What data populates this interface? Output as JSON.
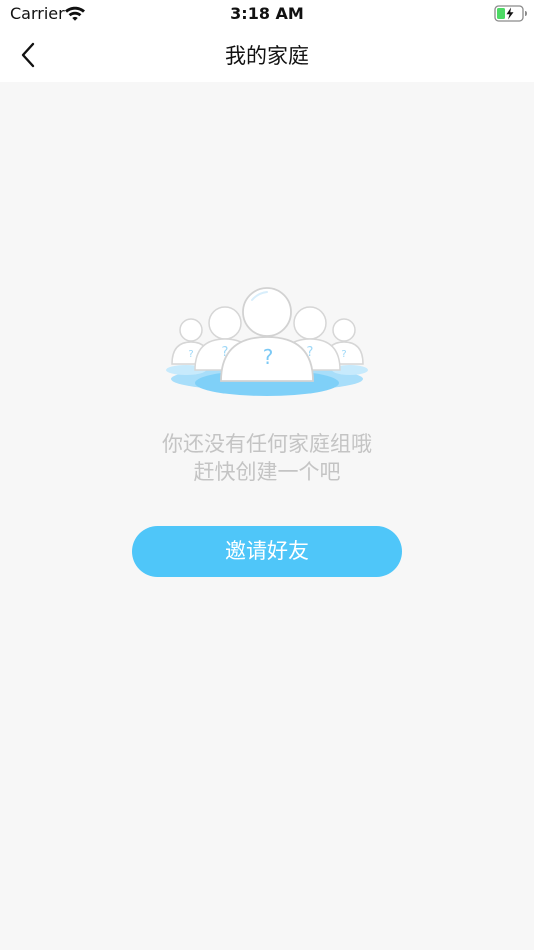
{
  "status_bar": {
    "carrier": "Carrier",
    "time": "3:18 AM",
    "wifi_icon": "wifi-icon",
    "battery_icon": "battery-charging-icon"
  },
  "nav": {
    "back_icon": "chevron-left-icon",
    "title": "我的家庭"
  },
  "empty_state": {
    "illustration_icon": "family-members-question-icon",
    "line1": "你还没有任何家庭组哦",
    "line2": "赶快创建一个吧",
    "question_mark": "?"
  },
  "actions": {
    "invite_label": "邀请好友"
  },
  "colors": {
    "accent": "#4fc6f9",
    "background": "#f7f7f7",
    "muted_text": "#c4c4c4",
    "battery_green": "#4cd964"
  }
}
